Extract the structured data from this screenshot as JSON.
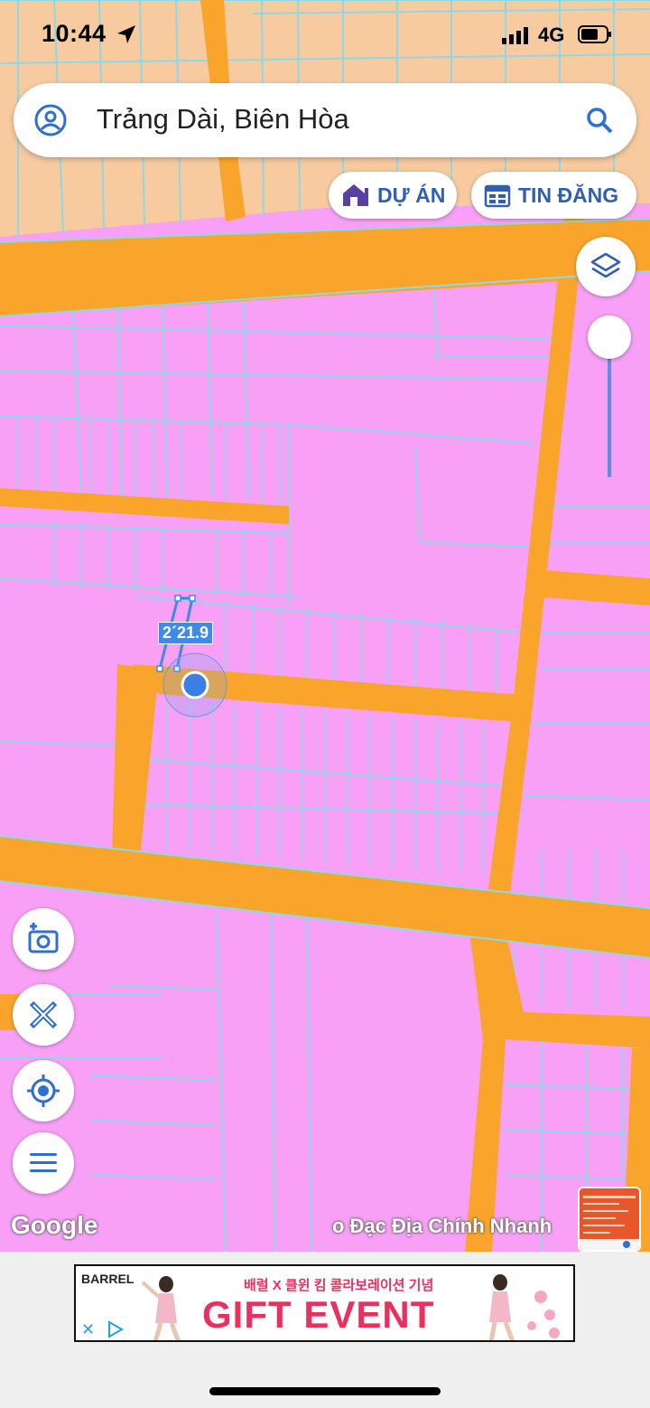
{
  "status_bar": {
    "time": "10:44",
    "network": "4G"
  },
  "search": {
    "query": "Trảng Dài, Biên Hòa"
  },
  "chips": {
    "du_an": "DỰ ÁN",
    "tin_dang": "TIN ĐĂNG"
  },
  "measurement": {
    "label": "2´21.9"
  },
  "map_attribution": {
    "google": "Google",
    "source": "o Đạc Địa Chính Nhanh"
  },
  "ad": {
    "brand": "BARREL",
    "korean": "배럴 X 클윈 킴 콜라보레이션 기념",
    "headline": "GIFT EVENT"
  },
  "colors": {
    "residential": "#f7a0f5",
    "road": "#f9a52c",
    "farmland": "#f7caa0",
    "parcel_line": "#8fd8e6",
    "accent": "#2f5fb3"
  },
  "icons": {
    "search_left": "user-icon",
    "search_right": "search-icon",
    "du_an": "house-icon",
    "tin_dang": "calendar-icon",
    "layers": "layers-icon",
    "camera": "camera-add-icon",
    "ruler": "ruler-pencil-icon",
    "locate": "locate-icon",
    "menu": "menu-icon"
  }
}
